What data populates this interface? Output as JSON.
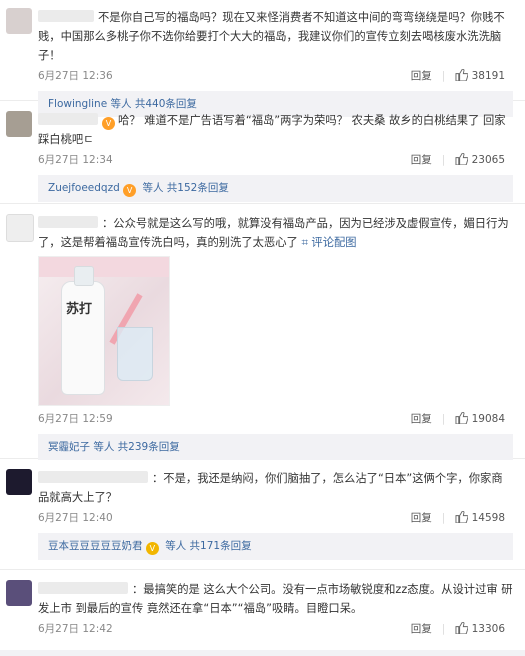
{
  "comments": [
    {
      "text": "不是你自己写的福岛吗？现在又来怪消费者不知道这中间的弯弯绕绕是吗？你贱不贱，中国那么多桃子你不选你给要打个大大的福岛，我建议你们的宣传立刻去喝核废水洗洗脑子！",
      "time": "6月27日 12:36",
      "reply": "回复",
      "likes": "38191",
      "replies_user": "Flowingline",
      "replies_text": "等人 共440条回复"
    },
    {
      "text": "哈？ 难道不是广告语写着“福岛”两字为荣吗？ 农夫桑 故乡的白桃结果了 回家踩白桃吧ㄷ",
      "time": "6月27日 12:34",
      "reply": "回复",
      "likes": "23065",
      "replies_user": "Zuejfoeedqzd",
      "replies_text": "等人 共152条回复"
    },
    {
      "text": "：公众号就是这么写的哦，就算没有福岛产品，因为已经涉及虚假宣传，媚日行为了，这是帮着福岛宣传洗白吗，真的别洗了太恶心了",
      "pic_comment": "评论配图",
      "bottle_text": "苏打",
      "time": "6月27日 12:59",
      "reply": "回复",
      "likes": "19084",
      "replies_user": "冥霾妃子",
      "replies_text": "等人 共239条回复"
    },
    {
      "text": "：不是，我还是纳闷，你们脑抽了，怎么沾了“日本”这俩个字，你家商品就高大上了？",
      "time": "6月27日 12:40",
      "reply": "回复",
      "likes": "14598",
      "replies_user": "豆本豆豆豆豆豆奶君",
      "replies_text": "等人 共171条回复"
    },
    {
      "text": "：最搞笑的是 这么大个公司。没有一点市场敏锐度和zz态度。从设计过审 研发上市 到最后的宣传 竟然还在拿“日本”“福岛”吸睛。目瞪口呆。",
      "time": "6月27日 12:42",
      "reply": "回复",
      "likes": "13306"
    }
  ]
}
